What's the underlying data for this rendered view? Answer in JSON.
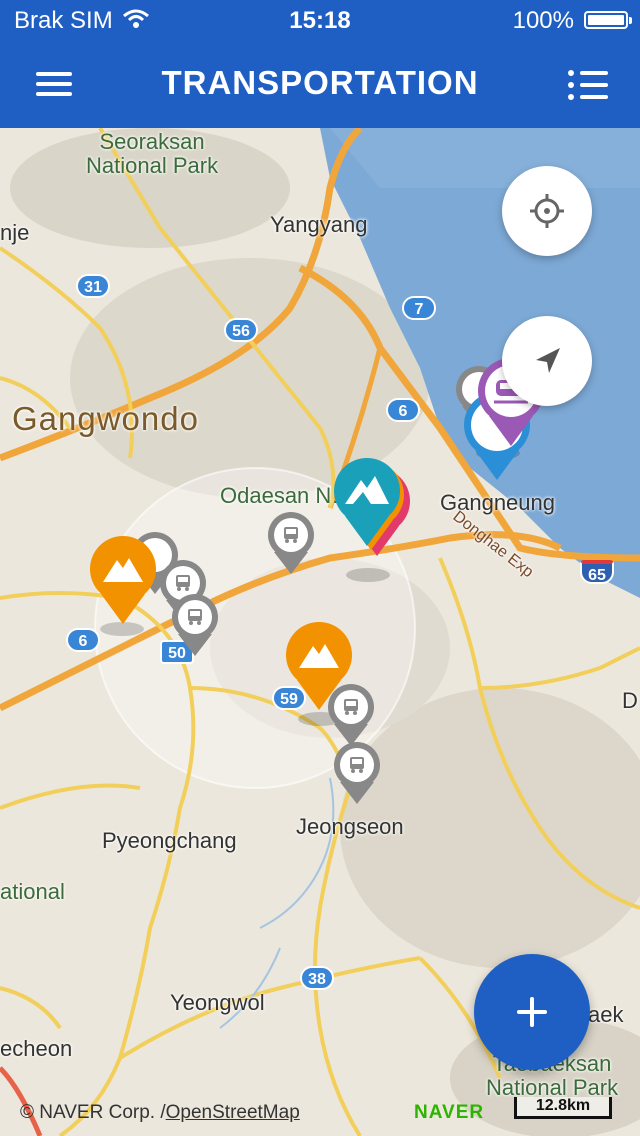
{
  "status_bar": {
    "carrier": "Brak SIM",
    "time": "15:18",
    "battery": "100%"
  },
  "header": {
    "title": "TRANSPORTATION"
  },
  "map": {
    "places": {
      "seoraksan": "Seoraksan\nNational Park",
      "inje": "nje",
      "yangyang": "Yangyang",
      "gangwondo": "Gangwondo",
      "odaesan": "Odaesan N…ark",
      "gangneung": "Gangneung",
      "donghae_exp": "Donghae Exp",
      "pyeongchang": "Pyeongchang",
      "jeongseon": "Jeongseon",
      "national_left": "ational",
      "yeongwol": "Yeongwol",
      "jecheon": "echeon",
      "taebaek": "aek",
      "taebaeksan": "Taebaeksan\nNational Park",
      "d_right": "D"
    },
    "routes": {
      "r31": "31",
      "r56": "56",
      "r7": "7",
      "r6a": "6",
      "r6b": "6",
      "r50": "50",
      "r59": "59",
      "r38": "38",
      "r65": "65"
    },
    "attribution": "© NAVER Corp. /",
    "attribution_osm": "OpenStreetMap",
    "logo": "NAVER",
    "scale": "12.8km"
  },
  "colors": {
    "header": "#1f5fc4",
    "orange_pin": "#f39200",
    "teal_pin": "#1aa0b8",
    "purple_pin": "#9b59b6",
    "gray_pin": "#888888",
    "blue_pin": "#2a8fd6"
  }
}
